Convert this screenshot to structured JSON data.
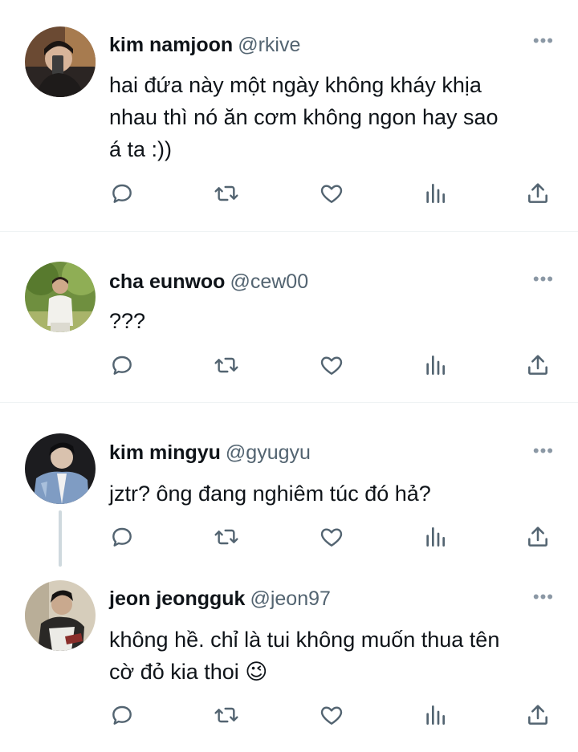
{
  "tweets": [
    {
      "name": "kim namjoon",
      "handle": "@rkive",
      "text_lines": [
        "hai đứa này một ngày không kháy khịa",
        "nhau thì nó ăn cơm không ngon hay sao",
        "á ta :))"
      ]
    },
    {
      "name": "cha eunwoo",
      "handle": "@cew00",
      "text_lines": [
        "???"
      ]
    },
    {
      "name": "kim mingyu",
      "handle": "@gyugyu",
      "text_lines": [
        "jztr? ông đang nghiêm túc đó hả?"
      ]
    },
    {
      "name": "jeon jeongguk",
      "handle": "@jeon97",
      "text_lines": [
        "không hề. chỉ là tui không muốn thua tên",
        "cờ đỏ kia thoi 😉"
      ]
    }
  ],
  "icons": {
    "more": "more-dots-icon",
    "reply": "reply-icon",
    "retweet": "retweet-icon",
    "like": "heart-icon",
    "views": "views-icon",
    "share": "share-icon"
  },
  "colors": {
    "text": "#0f1419",
    "secondary": "#536471",
    "icon": "#536471",
    "divider": "#eff3f4",
    "thread_line": "#cfd9de"
  }
}
